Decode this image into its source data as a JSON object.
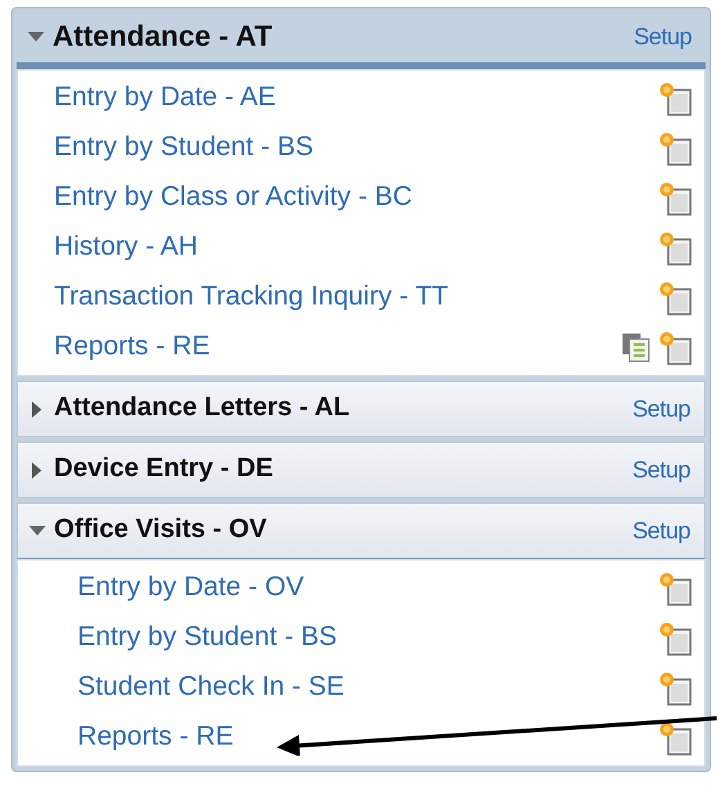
{
  "sections": [
    {
      "title": "Attendance - AT",
      "setup": "Setup",
      "expanded": true,
      "selected": true,
      "items": [
        {
          "label": "Entry by Date - AE",
          "report_icon": false
        },
        {
          "label": "Entry by Student - BS",
          "report_icon": false
        },
        {
          "label": "Entry by Class or Activity - BC",
          "report_icon": false
        },
        {
          "label": "History - AH",
          "report_icon": false
        },
        {
          "label": "Transaction Tracking Inquiry - TT",
          "report_icon": false
        },
        {
          "label": "Reports - RE",
          "report_icon": true
        }
      ]
    },
    {
      "title": "Attendance Letters - AL",
      "setup": "Setup",
      "expanded": false,
      "selected": false
    },
    {
      "title": "Device Entry - DE",
      "setup": "Setup",
      "expanded": false,
      "selected": false
    },
    {
      "title": "Office Visits - OV",
      "setup": "Setup",
      "expanded": true,
      "selected": false,
      "items": [
        {
          "label": "Entry by Date - OV",
          "report_icon": false
        },
        {
          "label": "Entry by Student - BS",
          "report_icon": false
        },
        {
          "label": "Student Check In - SE",
          "report_icon": false
        },
        {
          "label": "Reports - RE",
          "report_icon": false
        }
      ]
    }
  ]
}
